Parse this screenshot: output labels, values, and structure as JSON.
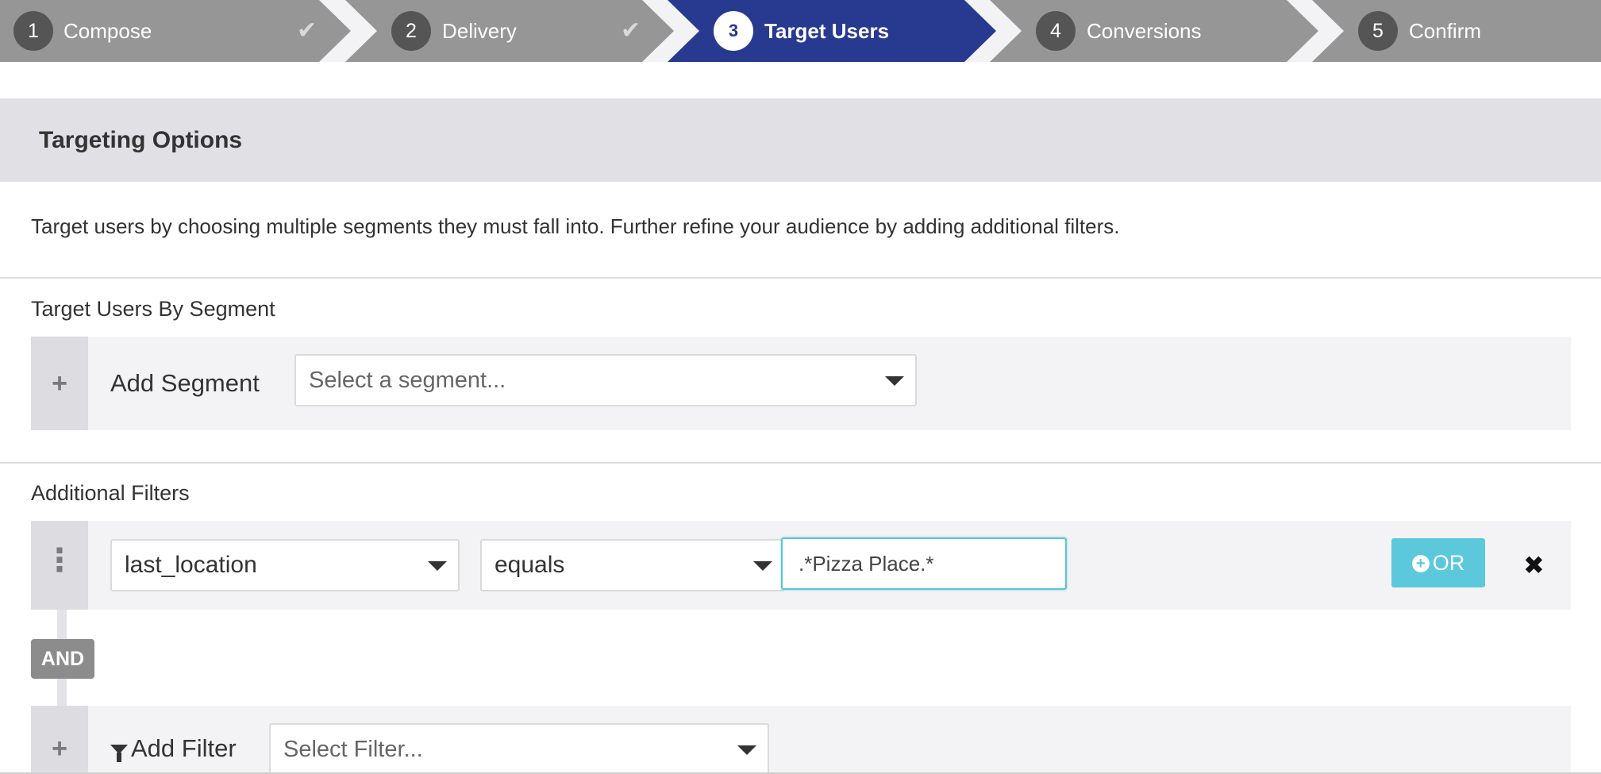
{
  "stepper": {
    "steps": [
      {
        "number": "1",
        "label": "Compose",
        "done": true
      },
      {
        "number": "2",
        "label": "Delivery",
        "done": true
      },
      {
        "number": "3",
        "label": "Target Users",
        "active": true
      },
      {
        "number": "4",
        "label": "Conversions"
      },
      {
        "number": "5",
        "label": "Confirm"
      }
    ],
    "check_glyph": "✔"
  },
  "header": {
    "title": "Targeting Options"
  },
  "description": "Target users by choosing multiple segments they must fall into. Further refine your audience by adding additional filters.",
  "segments": {
    "label": "Target Users By Segment",
    "add_label": "Add Segment",
    "select_placeholder": "Select a segment..."
  },
  "filters": {
    "label": "Additional Filters",
    "rows": [
      {
        "field": "last_location",
        "operator": "equals",
        "value": ".*Pizza Place.*"
      }
    ],
    "or_label": "OR",
    "and_label": "AND",
    "add_label": "Add Filter",
    "select_placeholder": "Select Filter..."
  },
  "icons": {
    "plus": "plus-icon",
    "drag": "drag-handle-icon",
    "close": "close-icon",
    "filter": "filter-icon",
    "checkmark": "checkmark-icon",
    "caret": "caret-down-icon"
  },
  "colors": {
    "active_step": "#283a8f",
    "inactive_step": "#969696",
    "or_button": "#5cc8dc",
    "input_focus": "#5cc3d6"
  }
}
